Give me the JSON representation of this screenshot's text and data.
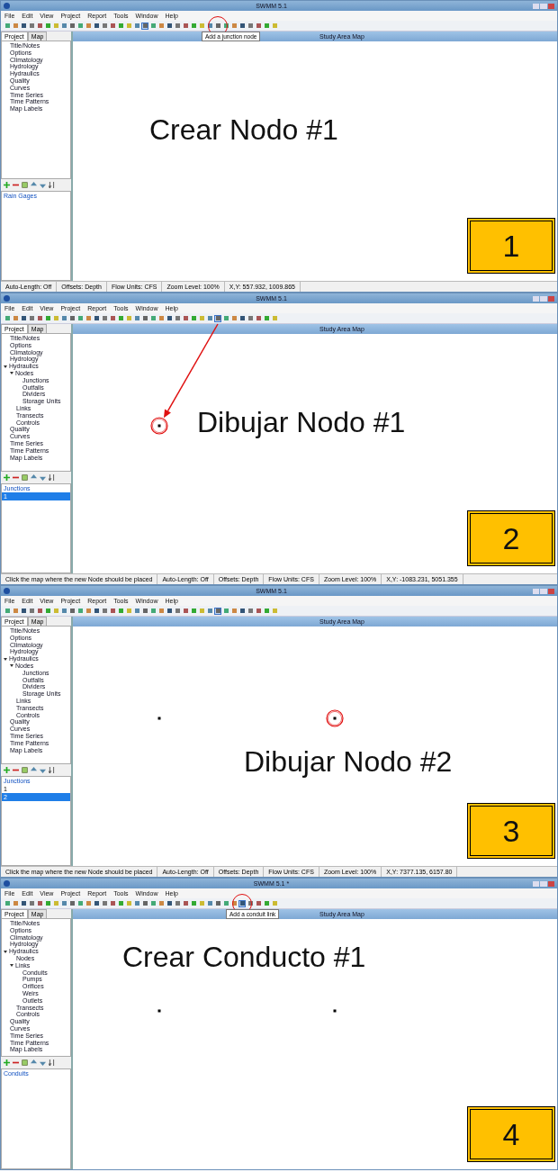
{
  "panels": [
    {
      "window_title": "SWMM 5.1",
      "menu": [
        "File",
        "Edit",
        "View",
        "Project",
        "Report",
        "Tools",
        "Window",
        "Help"
      ],
      "tools": [
        {
          "kind": "select",
          "pressed": true
        },
        {
          "kind": "junction",
          "pressed": false,
          "tooltip": "Add a junction node"
        },
        {
          "kind": "conduit",
          "pressed": false
        }
      ],
      "tabs": [
        {
          "label": "Project",
          "selected": true
        },
        {
          "label": "Map",
          "selected": false
        }
      ],
      "tree": [
        {
          "label": "Title/Notes"
        },
        {
          "label": "Options"
        },
        {
          "label": "Climatology"
        },
        {
          "label": "Hydrology"
        },
        {
          "label": "Hydraulics"
        },
        {
          "label": "Quality"
        },
        {
          "label": "Curves"
        },
        {
          "label": "Time Series"
        },
        {
          "label": "Time Patterns"
        },
        {
          "label": "Map Labels"
        }
      ],
      "object_list": {
        "header": "Rain Gages"
      },
      "map_title": "Study Area Map",
      "caption": "Crear Nodo #1",
      "step": "1",
      "status": {
        "fields": [
          "Auto-Length: Off",
          "Offsets: Depth",
          "Flow Units: CFS",
          "Zoom Level: 100%",
          "X,Y: 557.932, 1009.865"
        ]
      }
    },
    {
      "window_title": "SWMM 5.1",
      "menu": [
        "File",
        "Edit",
        "View",
        "Project",
        "Report",
        "Tools",
        "Window",
        "Help"
      ],
      "arrow": true,
      "tools": [
        {
          "kind": "select",
          "pressed": false
        },
        {
          "kind": "junction",
          "pressed": true
        },
        {
          "kind": "conduit",
          "pressed": false
        }
      ],
      "tabs": [
        {
          "label": "Project",
          "selected": true
        },
        {
          "label": "Map",
          "selected": false
        }
      ],
      "tree": [
        {
          "label": "Title/Notes"
        },
        {
          "label": "Options"
        },
        {
          "label": "Climatology"
        },
        {
          "label": "Hydrology"
        },
        {
          "label": "Hydraulics",
          "expanded": true,
          "children": [
            {
              "label": "Nodes",
              "expanded": true,
              "children": [
                {
                  "label": "Junctions"
                },
                {
                  "label": "Outfalls"
                },
                {
                  "label": "Dividers"
                },
                {
                  "label": "Storage Units"
                }
              ]
            },
            {
              "label": "Links"
            },
            {
              "label": "Transects"
            },
            {
              "label": "Controls"
            }
          ]
        },
        {
          "label": "Quality"
        },
        {
          "label": "Curves"
        },
        {
          "label": "Time Series"
        },
        {
          "label": "Time Patterns"
        },
        {
          "label": "Map Labels"
        }
      ],
      "object_list": {
        "header": "Junctions",
        "items": [
          {
            "label": "1",
            "selected": true
          }
        ]
      },
      "map_title": "Study Area Map",
      "caption": "Dibujar Nodo #1",
      "nodes": [
        {
          "kind": "highlighted"
        }
      ],
      "step": "2",
      "status": {
        "message": "Click the map where the new Node should be placed",
        "fields": [
          "Auto-Length: Off",
          "Offsets: Depth",
          "Flow Units: CFS",
          "Zoom Level: 100%",
          "X,Y: -1083.231, 5051.355"
        ]
      }
    },
    {
      "window_title": "SWMM 5.1",
      "menu": [
        "File",
        "Edit",
        "View",
        "Project",
        "Report",
        "Tools",
        "Window",
        "Help"
      ],
      "tools": [
        {
          "kind": "select",
          "pressed": false
        },
        {
          "kind": "junction",
          "pressed": true
        },
        {
          "kind": "conduit",
          "pressed": false
        }
      ],
      "tabs": [
        {
          "label": "Project",
          "selected": true
        },
        {
          "label": "Map",
          "selected": false
        }
      ],
      "tree": [
        {
          "label": "Title/Notes"
        },
        {
          "label": "Options"
        },
        {
          "label": "Climatology"
        },
        {
          "label": "Hydrology"
        },
        {
          "label": "Hydraulics",
          "expanded": true,
          "children": [
            {
              "label": "Nodes",
              "expanded": true,
              "children": [
                {
                  "label": "Junctions"
                },
                {
                  "label": "Outfalls"
                },
                {
                  "label": "Dividers"
                },
                {
                  "label": "Storage Units"
                }
              ]
            },
            {
              "label": "Links"
            },
            {
              "label": "Transects"
            },
            {
              "label": "Controls"
            }
          ]
        },
        {
          "label": "Quality"
        },
        {
          "label": "Curves"
        },
        {
          "label": "Time Series"
        },
        {
          "label": "Time Patterns"
        },
        {
          "label": "Map Labels"
        }
      ],
      "object_list": {
        "header": "Junctions",
        "items": [
          {
            "label": "1",
            "selected": false
          },
          {
            "label": "2",
            "selected": true
          }
        ]
      },
      "map_title": "Study Area Map",
      "caption": "Dibujar Nodo #2",
      "nodes": [
        {
          "kind": "plain"
        },
        {
          "kind": "highlighted"
        }
      ],
      "step": "3",
      "status": {
        "message": "Click the map where the new Node should be placed",
        "fields": [
          "Auto-Length: Off",
          "Offsets: Depth",
          "Flow Units: CFS",
          "Zoom Level: 100%",
          "X,Y: 7377.135, 6157.80"
        ]
      }
    },
    {
      "window_title": "SWMM 5.1 *",
      "menu": [
        "File",
        "Edit",
        "View",
        "Project",
        "Report",
        "Tools",
        "Window",
        "Help"
      ],
      "tools": [
        {
          "kind": "select",
          "pressed": false
        },
        {
          "kind": "junction",
          "pressed": false
        },
        {
          "kind": "conduit",
          "pressed": true,
          "tooltip": "Add a conduit link"
        }
      ],
      "tabs": [
        {
          "label": "Project",
          "selected": true
        },
        {
          "label": "Map",
          "selected": false
        }
      ],
      "tree": [
        {
          "label": "Title/Notes"
        },
        {
          "label": "Options"
        },
        {
          "label": "Climatology"
        },
        {
          "label": "Hydrology"
        },
        {
          "label": "Hydraulics",
          "expanded": true,
          "children": [
            {
              "label": "Nodes"
            },
            {
              "label": "Links",
              "expanded": true,
              "children": [
                {
                  "label": "Conduits"
                },
                {
                  "label": "Pumps"
                },
                {
                  "label": "Orifices"
                },
                {
                  "label": "Weirs"
                },
                {
                  "label": "Outlets"
                }
              ]
            },
            {
              "label": "Transects"
            },
            {
              "label": "Controls"
            }
          ]
        },
        {
          "label": "Quality"
        },
        {
          "label": "Curves"
        },
        {
          "label": "Time Series"
        },
        {
          "label": "Time Patterns"
        },
        {
          "label": "Map Labels"
        }
      ],
      "object_list": {
        "header": "Conduits"
      },
      "map_title": "Study Area Map",
      "caption": "Crear Conducto #1",
      "nodes": [
        {
          "kind": "plain"
        },
        {
          "kind": "plain"
        }
      ],
      "step": "4"
    }
  ]
}
